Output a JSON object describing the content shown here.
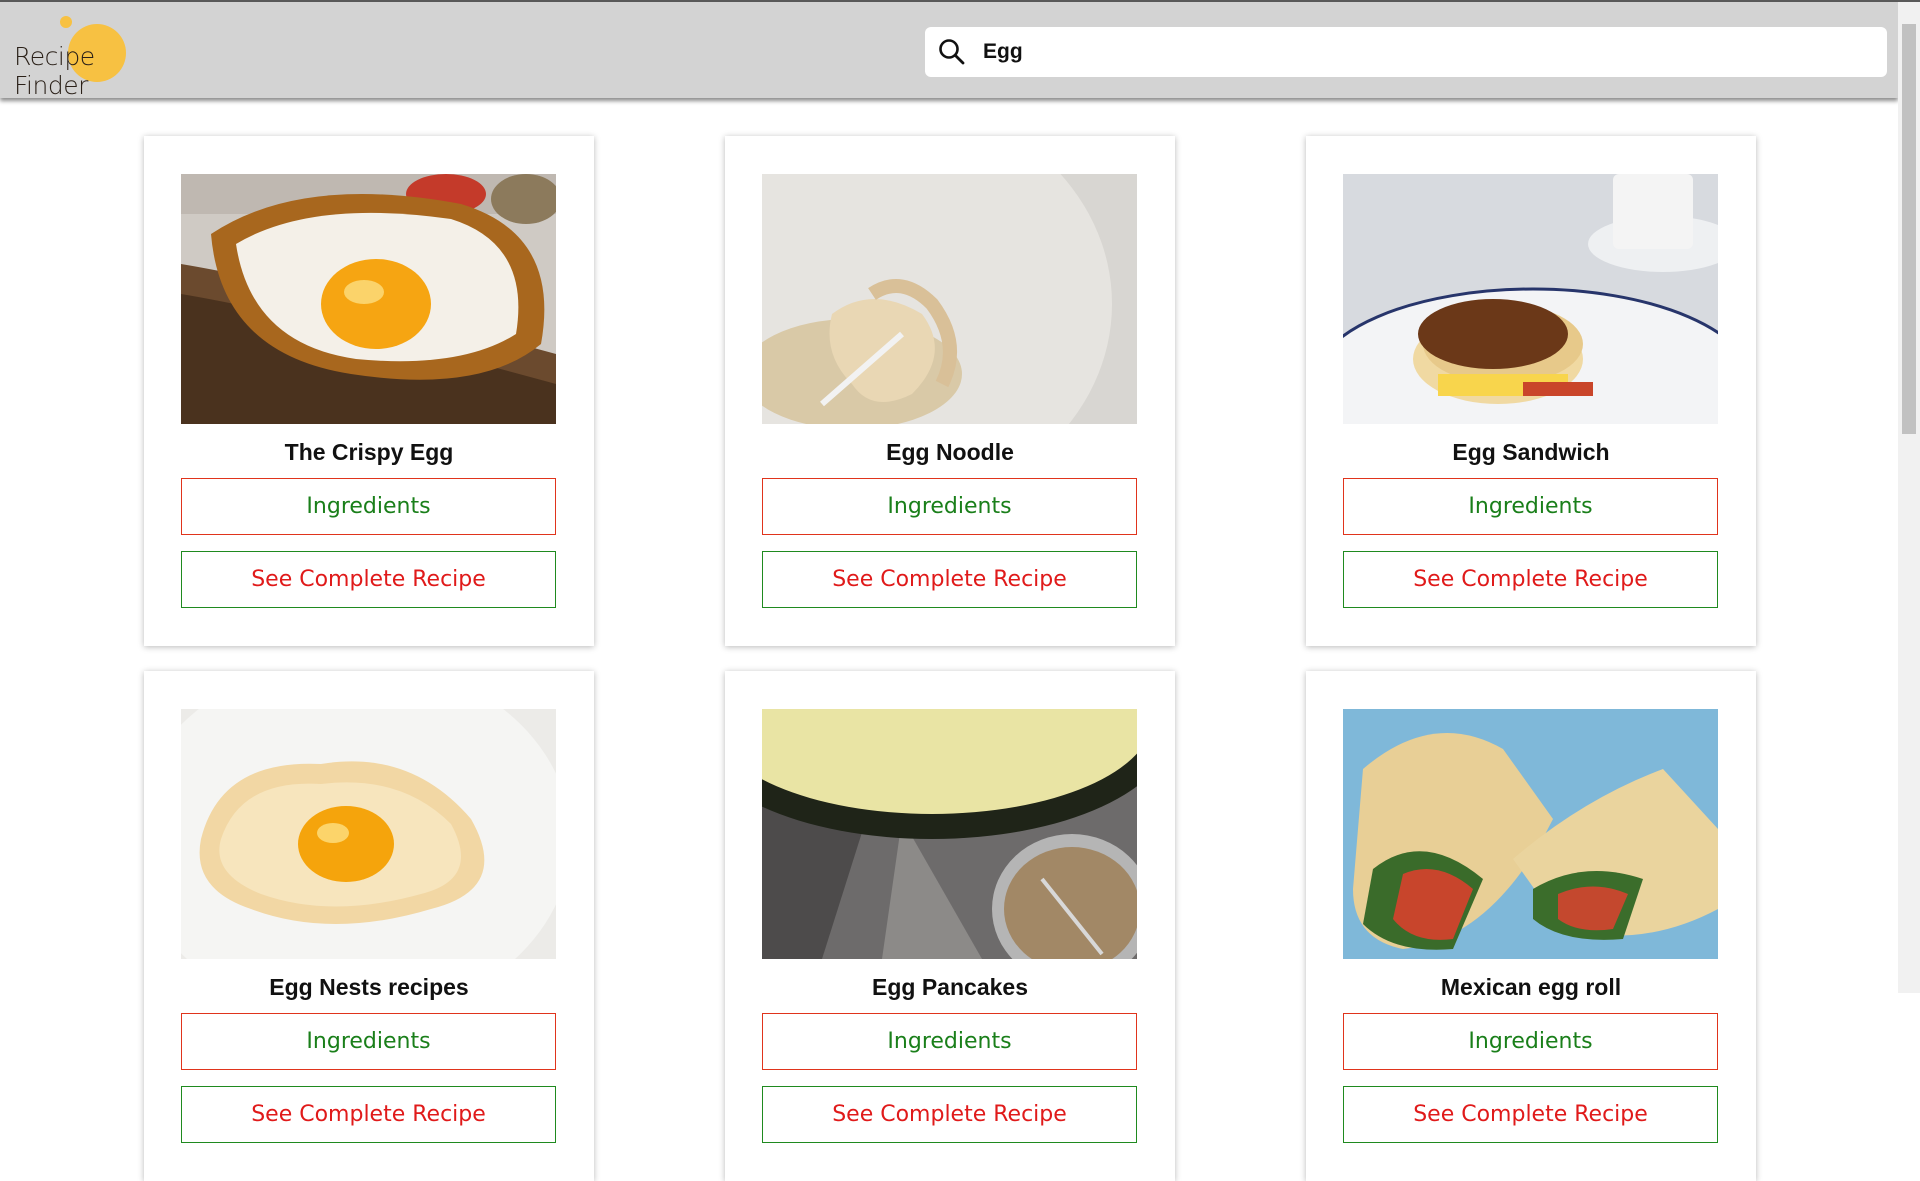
{
  "header": {
    "logo_text": "Recipe Finder",
    "search": {
      "value": "Egg",
      "icon": "search-icon"
    }
  },
  "colors": {
    "header_bg": "#d3d3d3",
    "logo_accent": "#f7c142",
    "ingredients_text": "#1a7f1a",
    "ingredients_border": "#e0341c",
    "recipe_text": "#e01a1a",
    "recipe_border": "#1f8a1f"
  },
  "cards": [
    {
      "title": "The Crispy Egg",
      "ingredients_label": "Ingredients",
      "recipe_label": "See Complete Recipe",
      "image": "fried-egg-on-toast"
    },
    {
      "title": "Egg Noodle",
      "ingredients_label": "Ingredients",
      "recipe_label": "See Complete Recipe",
      "image": "egg-noodles-in-bowl"
    },
    {
      "title": "Egg Sandwich",
      "ingredients_label": "Ingredients",
      "recipe_label": "See Complete Recipe",
      "image": "egg-muffin-sandwich"
    },
    {
      "title": "Egg Nests recipes",
      "ingredients_label": "Ingredients",
      "recipe_label": "See Complete Recipe",
      "image": "egg-nest-cloud"
    },
    {
      "title": "Egg Pancakes",
      "ingredients_label": "Ingredients",
      "recipe_label": "See Complete Recipe",
      "image": "pancake-in-pan"
    },
    {
      "title": "Mexican egg roll",
      "ingredients_label": "Ingredients",
      "recipe_label": "See Complete Recipe",
      "image": "egg-roll-wraps"
    }
  ]
}
